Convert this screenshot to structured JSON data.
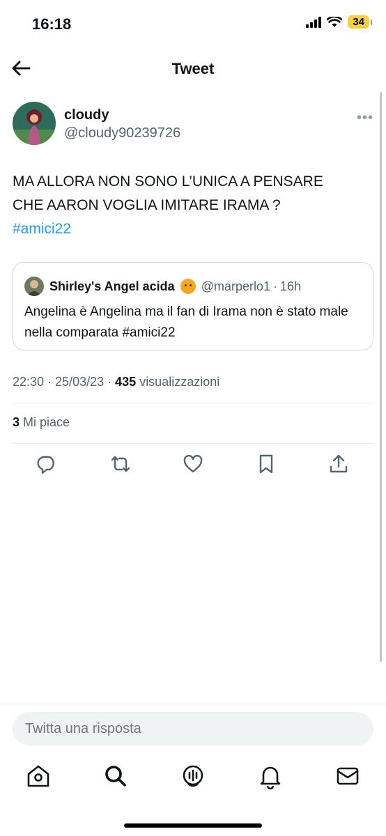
{
  "status_bar": {
    "time": "16:18",
    "battery": "34"
  },
  "header": {
    "title": "Tweet"
  },
  "tweet": {
    "author_name": "cloudy",
    "author_handle": "@cloudy90239726",
    "text_line1": "MA ALLORA NON SONO L’UNICA A PENSARE",
    "text_line2": "CHE AARON VOGLIA IMITARE IRAMA ?",
    "hashtag": "#amici22",
    "time": "22:30",
    "date": "25/03/23",
    "views": "435",
    "views_label": "visualizzazioni",
    "likes": "3",
    "likes_label": "Mi piace"
  },
  "quote": {
    "author_name": "Shirley's Angel acida",
    "author_handle": "@marperlo1",
    "time": "16h",
    "text": "Angelina è Angelina ma il fan di Irama non è stato male nella comparata #amici22"
  },
  "reply": {
    "placeholder": "Twitta una risposta"
  },
  "colors": {
    "accent": "#1d9bf0",
    "text": "#0f1419",
    "secondary": "#536471",
    "battery": "#f4d03f"
  },
  "icons": {
    "actions": [
      "reply-icon",
      "retweet-icon",
      "like-icon",
      "bookmark-icon",
      "share-icon"
    ],
    "tabs": [
      "home-icon",
      "search-icon",
      "spaces-icon",
      "notifications-icon",
      "messages-icon"
    ]
  }
}
